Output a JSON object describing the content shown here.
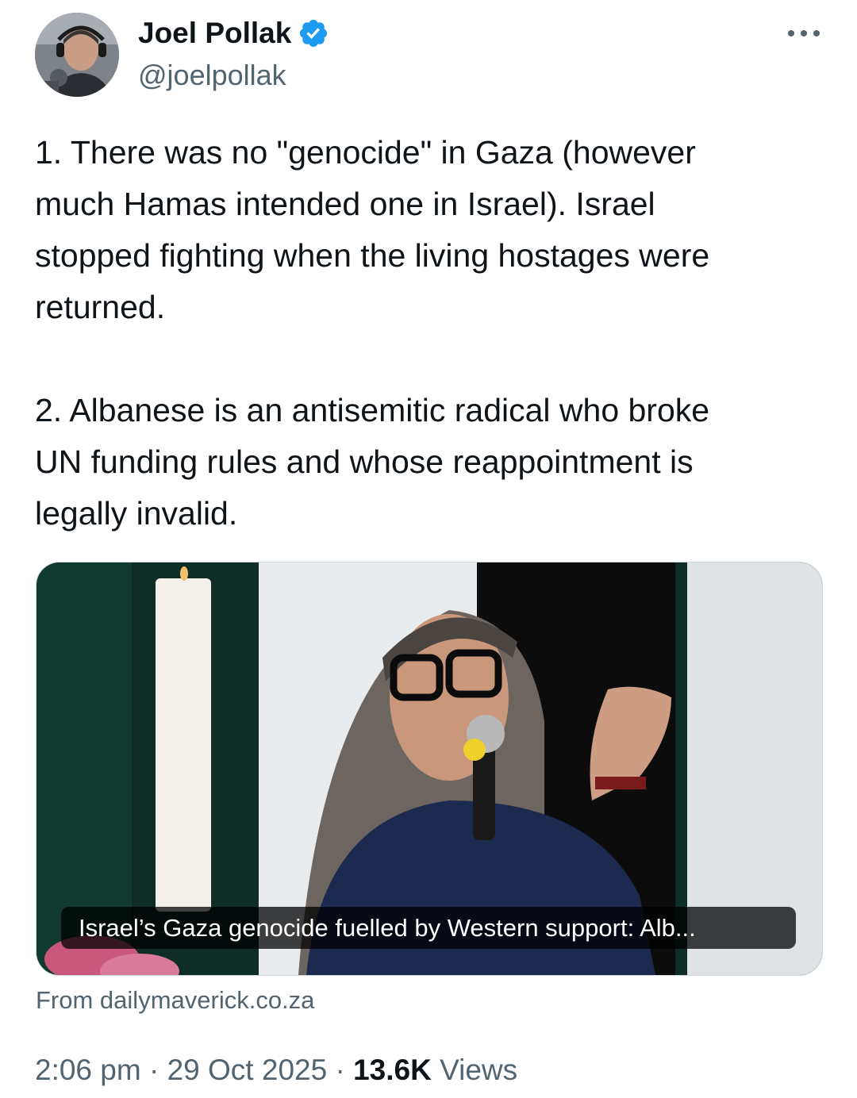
{
  "author": {
    "display_name": "Joel Pollak",
    "handle": "@joelpollak",
    "verified": true,
    "avatar_icon": "profile-photo-icon"
  },
  "more_icon": "more-horizontal-icon",
  "tweet": {
    "paragraph_1": "1. There was no \"genocide\" in Gaza (however\nmuch Hamas intended one in Israel). Israel\nstopped fighting when the living hostages were\nreturned.",
    "paragraph_2": "2. Albanese is an antisemitic radical who broke\nUN funding rules and whose reappointment is\nlegally invalid."
  },
  "link_card": {
    "caption": "Israel’s Gaza genocide fuelled by Western support: Alb...",
    "source": "From dailymaverick.co.za"
  },
  "meta": {
    "time": "2:06 pm",
    "separator": " · ",
    "date": "29 Oct 2025",
    "views_count": "13.6K",
    "views_label": "Views"
  },
  "colors": {
    "text_primary": "#0f1419",
    "text_secondary": "#536471",
    "verified_blue": "#1d9bf0",
    "card_border": "#cfd9de"
  }
}
